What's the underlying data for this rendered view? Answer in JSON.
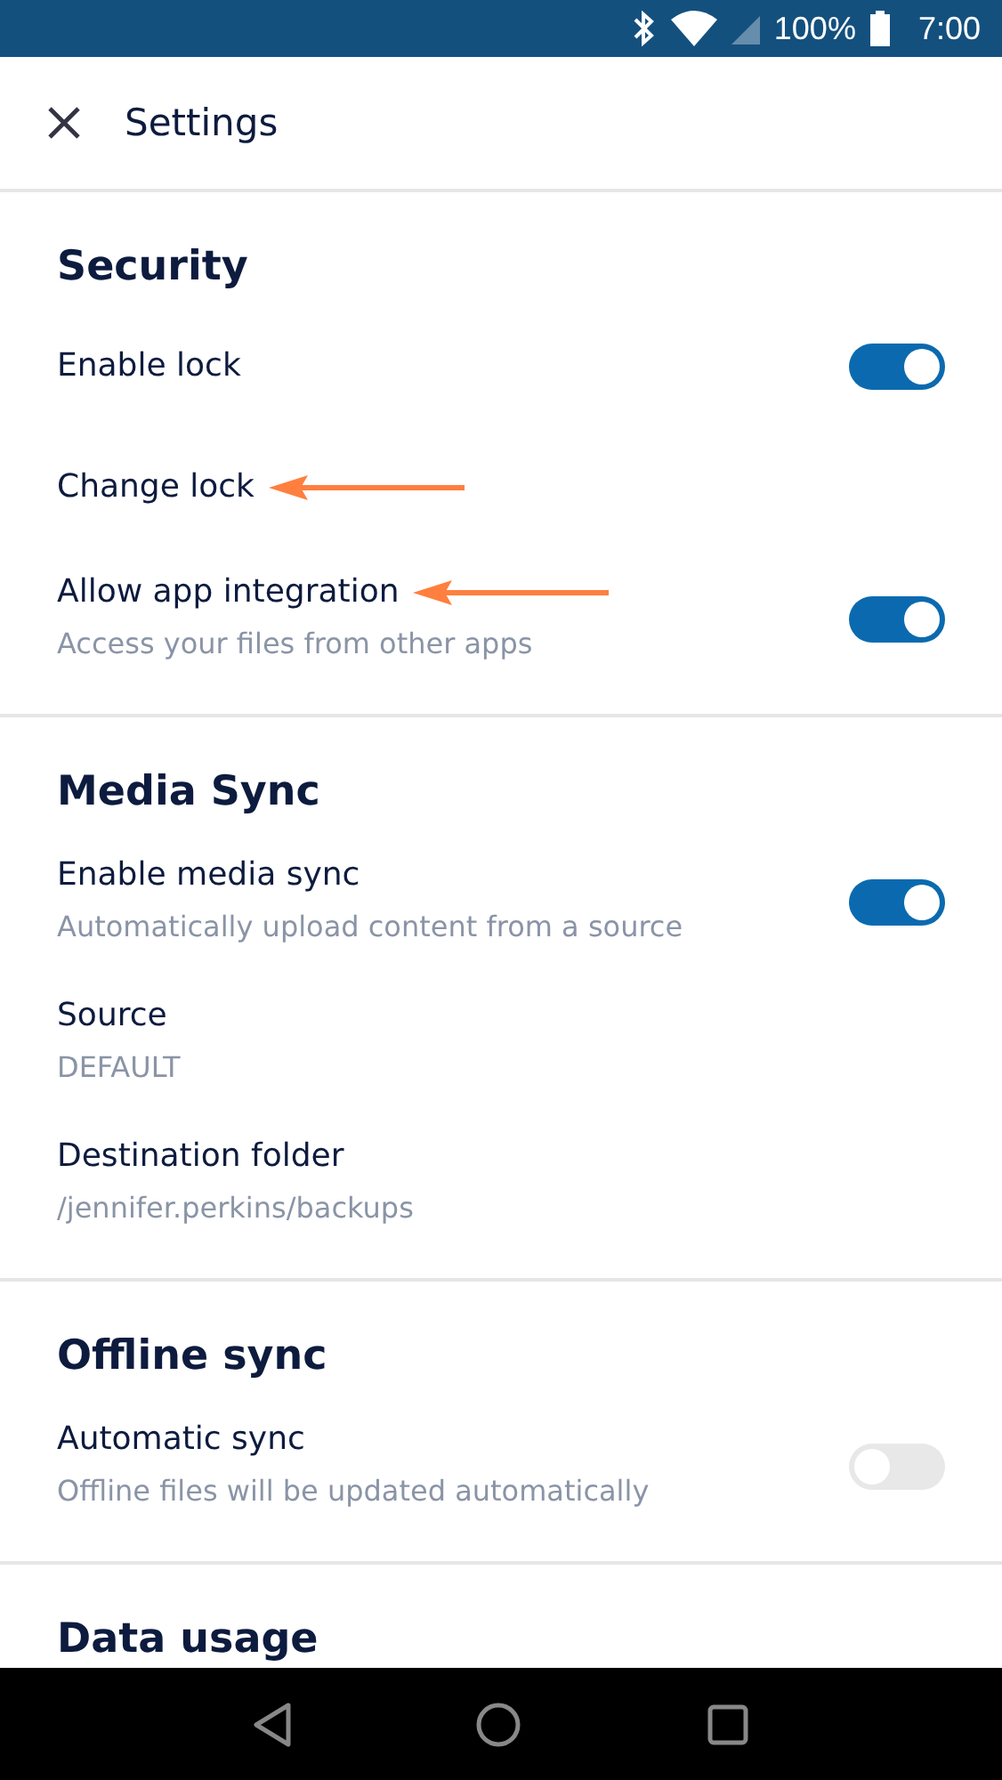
{
  "status_bar": {
    "battery": "100%",
    "time": "7:00"
  },
  "app_bar": {
    "title": "Settings"
  },
  "sections": [
    {
      "title": "Security",
      "items": [
        {
          "kind": "toggle",
          "title": "Enable lock",
          "on": true,
          "arrow": false
        },
        {
          "kind": "link",
          "title": "Change lock",
          "arrow": true
        },
        {
          "kind": "toggle",
          "title": "Allow app integration",
          "subtitle": "Access your files from other apps",
          "on": true,
          "arrow": true
        }
      ]
    },
    {
      "title": "Media Sync",
      "items": [
        {
          "kind": "toggle",
          "title": "Enable media sync",
          "subtitle": "Automatically upload content from a source",
          "on": true,
          "arrow": false
        },
        {
          "kind": "link",
          "title": "Source",
          "subtitle": "DEFAULT",
          "arrow": false
        },
        {
          "kind": "link",
          "title": "Destination folder",
          "subtitle": "/jennifer.perkins/backups",
          "arrow": false
        }
      ]
    },
    {
      "title": "Offline sync",
      "items": [
        {
          "kind": "toggle",
          "title": "Automatic sync",
          "subtitle": "Offline files will be updated automatically",
          "on": false,
          "arrow": false
        }
      ]
    },
    {
      "title": "Data usage"
    }
  ]
}
